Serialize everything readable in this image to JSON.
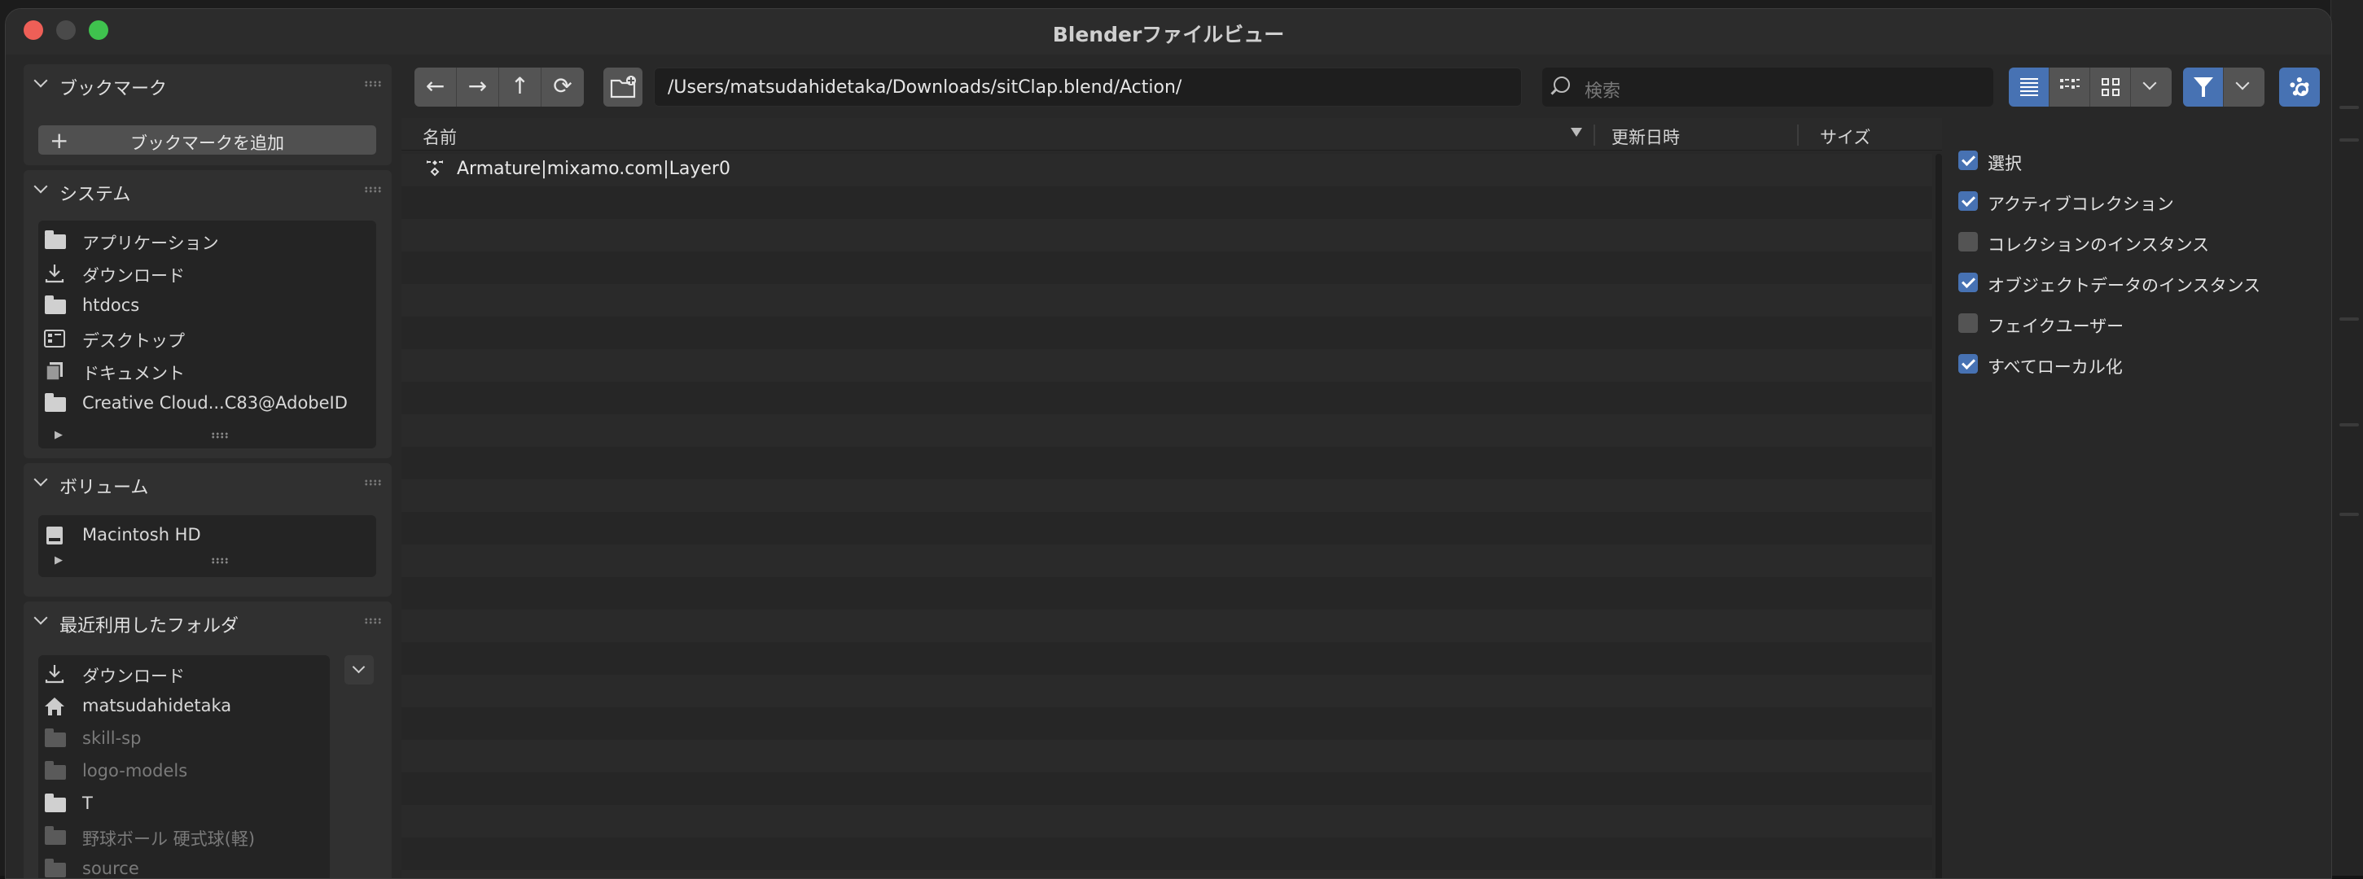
{
  "window": {
    "title": "Blenderファイルビュー"
  },
  "bookmarks": {
    "title": "ブックマーク",
    "add_label": "ブックマークを追加"
  },
  "system": {
    "title": "システム",
    "items": [
      {
        "label": "アプリケーション",
        "icon": "folder-icon"
      },
      {
        "label": "ダウンロード",
        "icon": "download-icon"
      },
      {
        "label": "htdocs",
        "icon": "folder-icon"
      },
      {
        "label": "デスクトップ",
        "icon": "desktop-icon"
      },
      {
        "label": "ドキュメント",
        "icon": "documents-icon"
      },
      {
        "label": "Creative Cloud...C83@AdobeID",
        "icon": "folder-icon"
      }
    ]
  },
  "volumes": {
    "title": "ボリューム",
    "items": [
      {
        "label": "Macintosh HD",
        "icon": "disk-icon"
      }
    ]
  },
  "recent": {
    "title": "最近利用したフォルダ",
    "items": [
      {
        "label": "ダウンロード",
        "icon": "download-icon",
        "dim": false
      },
      {
        "label": "matsudahidetaka",
        "icon": "home-icon",
        "dim": false
      },
      {
        "label": "skill-sp",
        "icon": "folder-icon",
        "dim": true
      },
      {
        "label": "logo-models",
        "icon": "folder-icon",
        "dim": true
      },
      {
        "label": "T",
        "icon": "folder-icon",
        "dim": false
      },
      {
        "label": "野球ボール 硬式球(軽)",
        "icon": "folder-icon",
        "dim": true
      },
      {
        "label": "source",
        "icon": "folder-icon",
        "dim": true
      }
    ]
  },
  "toolbar": {
    "back": "←",
    "forward": "→",
    "parent": "↑",
    "refresh": "⟳",
    "path_value": "/Users/matsudahidetaka/Downloads/sitClap.blend/Action/",
    "search_placeholder": "検索"
  },
  "columns": {
    "name": "名前",
    "modified": "更新日時",
    "size": "サイズ"
  },
  "files": [
    {
      "name": "Armature|mixamo.com|Layer0",
      "icon": "action-icon"
    }
  ],
  "options": [
    {
      "label": "選択",
      "checked": true
    },
    {
      "label": "アクティブコレクション",
      "checked": true
    },
    {
      "label": "コレクションのインスタンス",
      "checked": false
    },
    {
      "label": "オブジェクトデータのインスタンス",
      "checked": true
    },
    {
      "label": "フェイクユーザー",
      "checked": false
    },
    {
      "label": "すべてローカル化",
      "checked": true
    }
  ],
  "colors": {
    "accent": "#4772b3",
    "background": "#282828"
  }
}
